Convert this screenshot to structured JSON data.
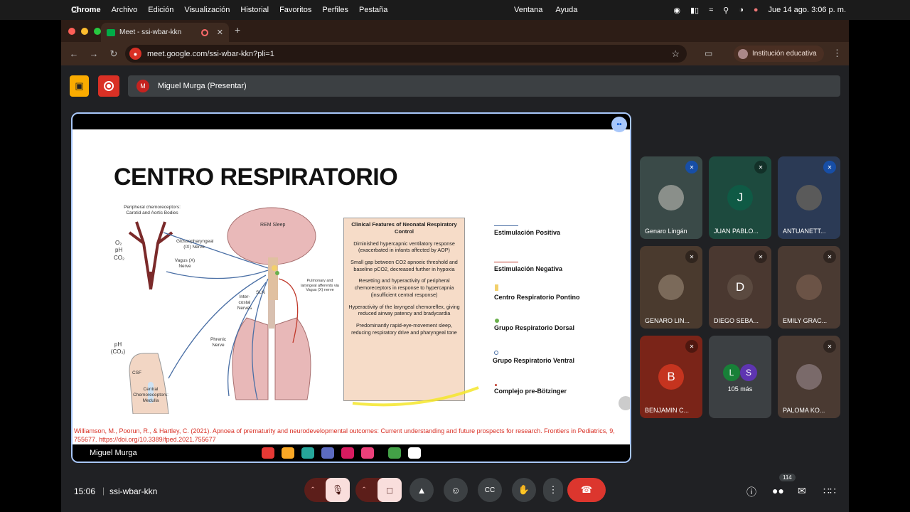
{
  "menubar": {
    "app": "Chrome",
    "menus": [
      "Archivo",
      "Edición",
      "Visualización",
      "Historial",
      "Favoritos",
      "Perfiles",
      "Pestaña"
    ],
    "center_menus": [
      "Ventana",
      "Ayuda"
    ],
    "clock": "Jue 14 ago.  3:06 p. m."
  },
  "browser": {
    "tab_title": "Meet - ssi-wbar-kkn",
    "url": "meet.google.com/ssi-wbar-kkn?pli=1",
    "profile_label": "Institución educativa"
  },
  "meet": {
    "presenter_initial": "M",
    "presenter_label": "Miguel Murga (Presentar)",
    "stage_name": "Miguel Murga",
    "time": "15:06",
    "meeting_code": "ssi-wbar-kkn",
    "participants_badge": "114"
  },
  "slide": {
    "title": "CENTRO RESPIRATORIO",
    "clinical_header": "Clinical Features of Neonatal Respiratory Control",
    "clinical_items": [
      "Diminished hypercapnic ventilatory response (exacerbated in infants affected by AOP)",
      "Small gap between CO2 apnoeic threshold and baseline pCO2, decreased further in hypoxia",
      "Resetting and hyperactivity of peripheral chemoreceptors in response to hypercapnia (insufficient central response)",
      "Hyperactivity of the laryngeal chemoreflex, giving reduced airway patency and bradycardia",
      "Predominantly rapid-eye-movement sleep, reducing respiratory drive and pharyngeal tone"
    ],
    "legend": [
      {
        "label": "Estimulación Positiva",
        "color": "#4a6fa5"
      },
      {
        "label": "Estimulación Negativa",
        "color": "#c0392b"
      },
      {
        "label": "Centro Respiratorio Pontino",
        "color": "#f2d06b"
      },
      {
        "label": "Grupo Respiratorio Dorsal",
        "color": "#6ab04c"
      },
      {
        "label": "Grupo Respiratorio Ventral",
        "color": "#4a6fa5"
      },
      {
        "label": "Complejo pre-Bötzinger",
        "color": "#c0392b"
      }
    ],
    "diagram_labels": {
      "peripheral": "Peripheral chemoreceptors: Carotid and Aortic Bodies",
      "o2": "O₂",
      "ph": "pH",
      "co2": "CO₂",
      "glosso": "Glossopharyngeal (IX) Nerve",
      "vagus": "Vagus (X) Nerve",
      "rem": "REM Sleep",
      "pulmonary": "Pulmonary and laryngeal afferents via Vagus (X) nerve",
      "intercostal": "Inter-costal Nerves",
      "sln": "SLN",
      "phrenic": "Phrenic Nerve",
      "ph_co2": "pH (CO₂)",
      "csf": "CSF",
      "central": "Central Chemoreceptors: Medulla"
    },
    "citation": "Williamson, M., Poorun, R., & Hartley, C. (2021). Apnoea of prematurity and neurodevelopmental outcomes: Current understanding and future prospects for research. Frontiers in Pediatrics, 9, 755677. https://doi.org/10.3389/fped.2021.755677"
  },
  "participants": [
    {
      "name": "Genaro Lingán",
      "initial": "",
      "bg": "#3a4a48",
      "avatar_bg": "#8a8f8a",
      "muted": true
    },
    {
      "name": "JUAN PABLO...",
      "initial": "J",
      "bg": "#1d4a3e",
      "avatar_bg": "#0f5a45",
      "muted": true
    },
    {
      "name": "ANTUANETT...",
      "initial": "",
      "bg": "#2b3a55",
      "avatar_bg": "#5a5a5a",
      "muted": true
    },
    {
      "name": "GENARO LIN...",
      "initial": "",
      "bg": "#4a3a2e",
      "avatar_bg": "#7b6a5a",
      "muted": true
    },
    {
      "name": "DIEGO SEBA...",
      "initial": "D",
      "bg": "#4a3830",
      "avatar_bg": "#5b4a40",
      "muted": true
    },
    {
      "name": "EMILY GRAC...",
      "initial": "",
      "bg": "#4a3a32",
      "avatar_bg": "#6b5346",
      "muted": true
    },
    {
      "name": "BENJAMIN C...",
      "initial": "B",
      "bg": "#7a2418",
      "avatar_bg": "#c5341f",
      "muted": true
    },
    {
      "name": "105 más",
      "initial": "",
      "bg": "#3c4043",
      "avatar_bg": "",
      "muted": false
    },
    {
      "name": "PALOMA KO...",
      "initial": "",
      "bg": "#4a3a32",
      "avatar_bg": "#7a6a6a",
      "muted": true
    }
  ],
  "more_initials": [
    "L",
    "S"
  ]
}
